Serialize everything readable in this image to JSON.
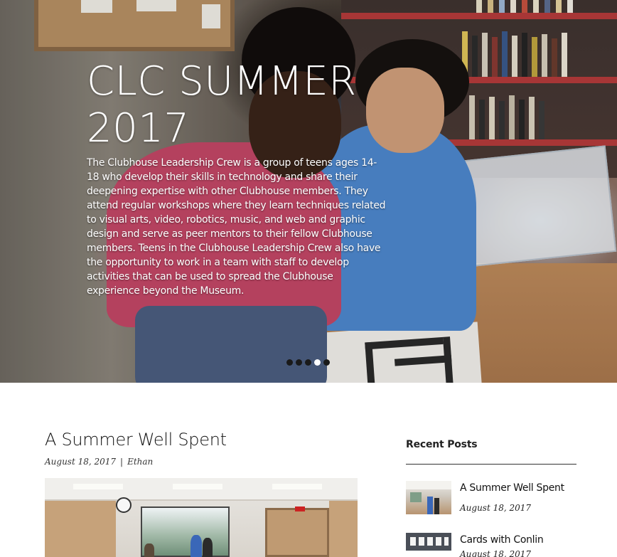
{
  "hero": {
    "title": "CLC SUMMER 2017",
    "description": "The Clubhouse Leadership Crew is a group of teens ages 14-18 who develop their skills in technology and share their deepening expertise with other Clubhouse members. They attend regular workshops where they learn techniques related to visual arts, video, robotics, music, and web and graphic design and serve as peer mentors to their fellow Clubhouse members. Teens in the Clubhouse Leadership Crew also have the opportunity to work in a team with staff to develop activities that can be used to spread the Clubhouse experience beyond the Museum.",
    "slides": 5,
    "active_slide": 4
  },
  "post": {
    "title": "A Summer Well Spent",
    "date": "August 18, 2017",
    "separator": "|",
    "author": "Ethan"
  },
  "sidebar": {
    "heading": "Recent Posts",
    "items": [
      {
        "title": "A Summer Well Spent",
        "date": "August 18, 2017"
      },
      {
        "title": "Cards with Conlin",
        "date": "August 18, 2017"
      }
    ]
  },
  "colors": {
    "text": "#111111",
    "hero_text": "#ffffff",
    "dot_active": "#ffffff",
    "dot_inactive": "#1a1a1a",
    "rule": "#333333"
  }
}
